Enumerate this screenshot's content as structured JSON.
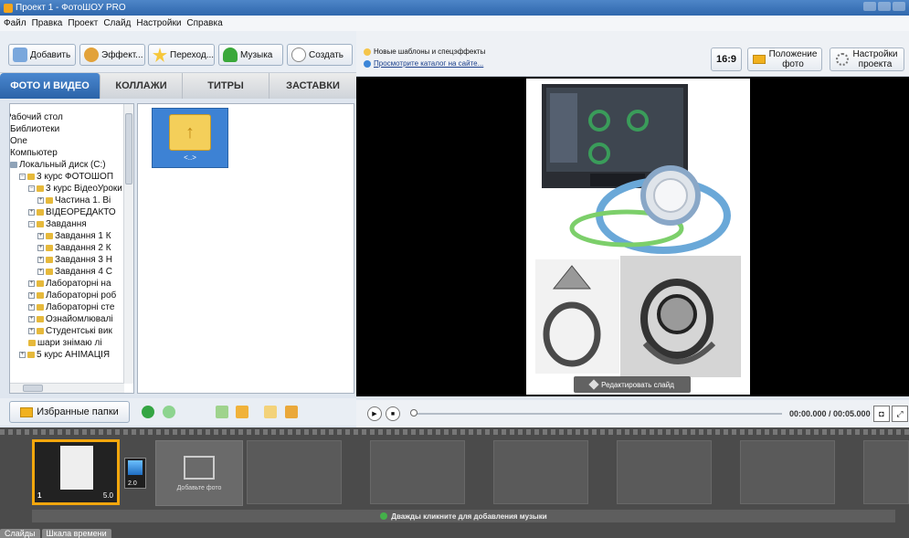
{
  "title": "Проект 1 - ФотоШОУ PRO",
  "menu": [
    "Файл",
    "Правка",
    "Проект",
    "Слайд",
    "Настройки",
    "Справка"
  ],
  "toolbar": {
    "add": "Добавить",
    "effects": "Эффект...",
    "transitions": "Переход...",
    "music": "Музыка",
    "create": "Создать"
  },
  "links": {
    "templates": "Новые шаблоны и спецэффекты",
    "catalog": "Просмотрите каталог на сайте..."
  },
  "right_buttons": {
    "ratio": "16:9",
    "photo_position": "Положение\nфото",
    "project_settings": "Настройки\nпроекта"
  },
  "tabs": [
    "ФОТО И ВИДЕО",
    "КОЛЛАЖИ",
    "ТИТРЫ",
    "ЗАСТАВКИ"
  ],
  "tree": [
    {
      "label": "Рабочий стол",
      "indent": 0,
      "icon": "none"
    },
    {
      "label": "Библиотеки",
      "indent": 0,
      "icon": "none"
    },
    {
      "label": "One",
      "indent": 0,
      "icon": "none"
    },
    {
      "label": "Компьютер",
      "indent": 0,
      "icon": "none"
    },
    {
      "label": "Локальный диск (C:)",
      "indent": 0,
      "icon": "drive"
    },
    {
      "label": "3 курс ФОТОШОП",
      "indent": 1,
      "icon": "folder",
      "exp": "−"
    },
    {
      "label": "3 курс ВідеоУроки",
      "indent": 2,
      "icon": "folder",
      "exp": "−"
    },
    {
      "label": "Частина 1. Ві",
      "indent": 3,
      "icon": "folder",
      "exp": "+"
    },
    {
      "label": "ВІДЕОРЕДАКТО",
      "indent": 2,
      "icon": "folder",
      "exp": "+"
    },
    {
      "label": "Завдання",
      "indent": 2,
      "icon": "folder",
      "exp": "−"
    },
    {
      "label": "Завдання 1 К",
      "indent": 3,
      "icon": "folder",
      "exp": "+"
    },
    {
      "label": "Завдання 2 К",
      "indent": 3,
      "icon": "folder",
      "exp": "+"
    },
    {
      "label": "Завдання 3 Н",
      "indent": 3,
      "icon": "folder",
      "exp": "+"
    },
    {
      "label": "Завдання 4 С",
      "indent": 3,
      "icon": "folder",
      "exp": "+"
    },
    {
      "label": "Лабораторні на",
      "indent": 2,
      "icon": "folder",
      "exp": "+"
    },
    {
      "label": "Лабораторні роб",
      "indent": 2,
      "icon": "folder",
      "exp": "+"
    },
    {
      "label": "Лабораторні сте",
      "indent": 2,
      "icon": "folder",
      "exp": "+"
    },
    {
      "label": "Ознайомлювалі",
      "indent": 2,
      "icon": "folder",
      "exp": "+"
    },
    {
      "label": "Студентські вик",
      "indent": 2,
      "icon": "folder",
      "exp": "+"
    },
    {
      "label": "шари знімаю лі",
      "indent": 2,
      "icon": "folder",
      "exp": ""
    },
    {
      "label": "5 курс АНІМАЦІЯ",
      "indent": 1,
      "icon": "folder",
      "exp": "+"
    }
  ],
  "up_folder_label": "<..>",
  "favorites": "Избранные папки",
  "edit_slide": "Редактировать слайд",
  "time": "00:00.000 / 00:05.000",
  "slides": [
    {
      "index": "1",
      "duration": "5.0"
    }
  ],
  "transition_duration": "2.0",
  "add_photo": "Добавьте фото",
  "music_hint": "Дважды кликните для добавления музыки",
  "bottom_tabs": [
    "Слайды",
    "Шкала времени"
  ],
  "colors": {
    "accent": "#2f6fbf",
    "selection": "#f3a70d"
  }
}
